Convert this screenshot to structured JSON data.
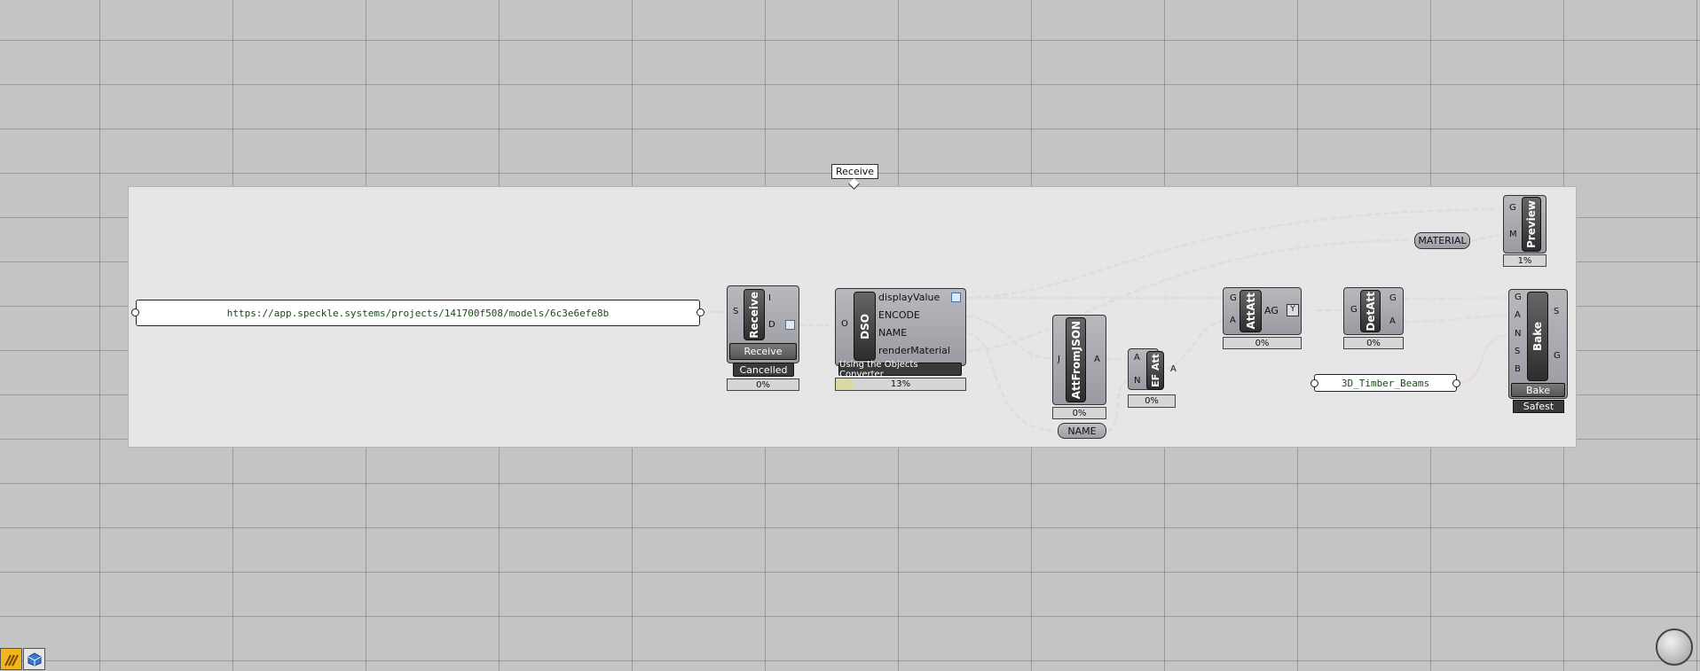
{
  "canvas": {
    "group_label": "Receive"
  },
  "url_panel": {
    "text": "https://app.speckle.systems/projects/141700f508/models/6c3e6efe8b"
  },
  "receive": {
    "name": "Receive",
    "inputs": [
      "S"
    ],
    "outputs": [
      "I",
      "D"
    ],
    "button_label": "Receive",
    "status": "Cancelled",
    "progress": "0%"
  },
  "dso": {
    "name": "DSO",
    "inputs": [
      "O"
    ],
    "outputs": [
      "displayValue",
      "ENCODE",
      "NAME",
      "renderMaterial"
    ],
    "message": "Using the Objects Converter",
    "progress": "13%"
  },
  "attfromjson": {
    "name": "AttFromJSON",
    "inputs": [
      "J"
    ],
    "outputs": [
      "A"
    ],
    "progress": "0%"
  },
  "name_pill": {
    "label": "NAME"
  },
  "efatt": {
    "name": "EF Att",
    "inputs": [
      "A",
      "N"
    ],
    "outputs": [
      "A"
    ],
    "progress": "0%"
  },
  "attatt": {
    "name": "AttAtt",
    "inputs": [
      "G",
      "A"
    ],
    "outputs": [
      "AG"
    ],
    "progress": "0%"
  },
  "detatt": {
    "name": "DetAtt",
    "inputs": [
      "G"
    ],
    "outputs": [
      "G",
      "A"
    ],
    "progress": "0%"
  },
  "material_pill": {
    "label": "MATERIAL"
  },
  "preview": {
    "name": "Preview",
    "inputs": [
      "G",
      "M"
    ],
    "progress": "1%"
  },
  "bake": {
    "name": "Bake",
    "inputs": [
      "G",
      "A",
      "N",
      "S",
      "B"
    ],
    "outputs": [
      "S",
      "G"
    ],
    "button_label": "Bake",
    "mode": "Safest"
  },
  "beams_panel": {
    "text": "3D_Timber_Beams"
  },
  "toolbar": {
    "icons": [
      "speckle-icon",
      "cube-icon"
    ]
  },
  "colors": {
    "canvas_bg": "#c4c4c4",
    "group_bg": "#e8e8e8",
    "wire": "#555555",
    "selected_wire": "#e01e8c",
    "progress_fill": "#d9d9a6"
  }
}
